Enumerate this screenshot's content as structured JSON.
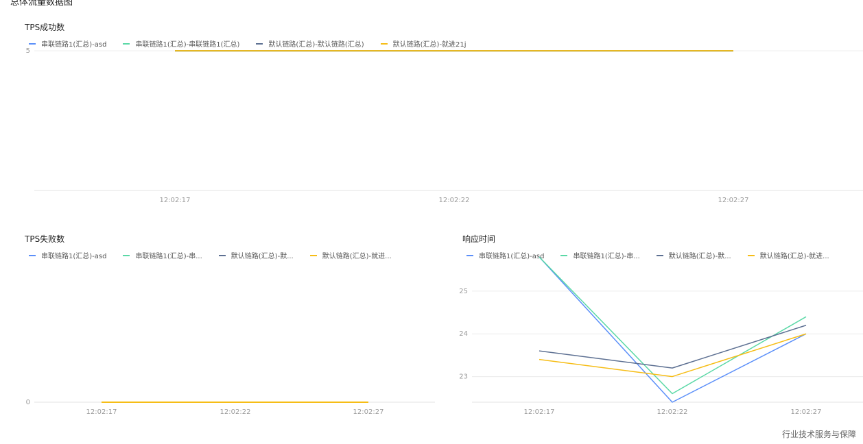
{
  "page": {
    "title": "总体流量数据图",
    "footer": "行业技术服务与保障"
  },
  "chart_data": [
    {
      "type": "line",
      "title": "TPS成功数",
      "x": [
        "12:02:17",
        "12:02:22",
        "12:02:27"
      ],
      "xticks": [
        "12:02:17",
        "12:02:22",
        "12:02:27"
      ],
      "yticks": [
        5
      ],
      "ylim": [
        0,
        5.2
      ],
      "grid": true,
      "legend_position": "top-left",
      "series": [
        {
          "name": "串联链路1(汇总)-asd",
          "color": "#5b8ff9",
          "values": [
            5,
            5,
            5
          ]
        },
        {
          "name": "串联链路1(汇总)-串联链路1(汇总)",
          "color": "#5ad8a6",
          "values": [
            5,
            5,
            5
          ]
        },
        {
          "name": "默认链路(汇总)-默认链路(汇总)",
          "color": "#5d7092",
          "values": [
            5,
            5,
            5
          ]
        },
        {
          "name": "默认链路(汇总)-就进21j",
          "color": "#f6bd16",
          "values": [
            5,
            5,
            5
          ]
        }
      ]
    },
    {
      "type": "line",
      "title": "TPS失败数",
      "x": [
        "12:02:17",
        "12:02:22",
        "12:02:27"
      ],
      "xticks": [
        "12:02:17",
        "12:02:22",
        "12:02:27"
      ],
      "yticks": [
        0
      ],
      "ylim": [
        0,
        5
      ],
      "grid": true,
      "legend_position": "top-left",
      "series": [
        {
          "name": "串联链路1(汇总)-asd",
          "legend_label": "串联链路1(汇总)-asd",
          "color": "#5b8ff9",
          "values": [
            0,
            0,
            0
          ]
        },
        {
          "name": "串联链路1(汇总)-串联链路1(汇总)",
          "legend_label": "串联链路1(汇总)-串...",
          "color": "#5ad8a6",
          "values": [
            0,
            0,
            0
          ]
        },
        {
          "name": "默认链路(汇总)-默认链路(汇总)",
          "legend_label": "默认链路(汇总)-默...",
          "color": "#5d7092",
          "values": [
            0,
            0,
            0
          ]
        },
        {
          "name": "默认链路(汇总)-就进21j",
          "legend_label": "默认链路(汇总)-就进...",
          "color": "#f6bd16",
          "values": [
            0,
            0,
            0
          ]
        }
      ]
    },
    {
      "type": "line",
      "title": "响应时间",
      "x": [
        "12:02:17",
        "12:02:22",
        "12:02:27"
      ],
      "xticks": [
        "12:02:17",
        "12:02:22",
        "12:02:27"
      ],
      "yticks": [
        23,
        24,
        25
      ],
      "ylim": [
        22.4,
        25.8
      ],
      "grid": true,
      "legend_position": "top-left",
      "series": [
        {
          "name": "串联链路1(汇总)-asd",
          "legend_label": "串联链路1(汇总)-asd",
          "color": "#5b8ff9",
          "values": [
            25.8,
            22.4,
            24.0
          ]
        },
        {
          "name": "串联链路1(汇总)-串联链路1(汇总)",
          "legend_label": "串联链路1(汇总)-串...",
          "color": "#5ad8a6",
          "values": [
            25.8,
            22.6,
            24.4
          ]
        },
        {
          "name": "默认链路(汇总)-默认链路(汇总)",
          "legend_label": "默认链路(汇总)-默...",
          "color": "#5d7092",
          "values": [
            23.6,
            23.2,
            24.2
          ]
        },
        {
          "name": "默认链路(汇总)-就进21j",
          "legend_label": "默认链路(汇总)-就进...",
          "color": "#f6bd16",
          "values": [
            23.4,
            23.0,
            24.0
          ]
        }
      ]
    }
  ]
}
